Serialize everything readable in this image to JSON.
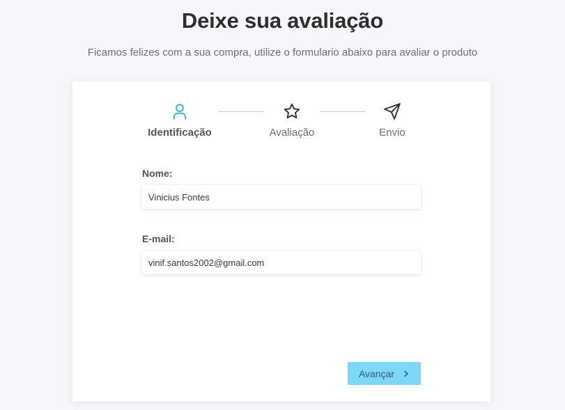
{
  "header": {
    "title": "Deixe sua avaliação",
    "subtitle": "Ficamos felizes com a sua compra, utilize o formulario abaixo para avaliar o produto"
  },
  "steps": [
    {
      "label": "Identificação",
      "icon": "user-icon",
      "active": true,
      "color": "#2bb8e6"
    },
    {
      "label": "Avaliação",
      "icon": "star-icon",
      "active": false
    },
    {
      "label": "Envio",
      "icon": "send-icon",
      "active": false
    }
  ],
  "form": {
    "name_label": "Nome:",
    "name_value": "Vinicius Fontes",
    "email_label": "E-mail:",
    "email_value": "vinif.santos2002@gmail.com"
  },
  "actions": {
    "next_label": "Avançar",
    "next_color": "#7dd8f7"
  }
}
